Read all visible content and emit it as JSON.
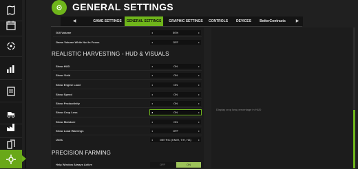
{
  "header": {
    "title": "GENERAL SETTINGS"
  },
  "tabs": {
    "prev_icon": "◀",
    "next_icon": "▶",
    "items": [
      {
        "label": "GAME SETTINGS"
      },
      {
        "label": "GENERAL SETTINGS",
        "active": true
      },
      {
        "label": "GRAPHIC SETTINGS"
      },
      {
        "label": "CONTROLS"
      },
      {
        "label": "DEVICES"
      },
      {
        "label": "BetterContracts"
      }
    ]
  },
  "settings": {
    "rows_top": [
      {
        "label": "GUI Volume",
        "value": "50%"
      },
      {
        "label": "Game Volume While Not In Focus",
        "value": "OFF"
      }
    ],
    "section_rh": {
      "title": "REALISTIC HARVESTING - HUD & VISUALS"
    },
    "rows_rh": [
      {
        "label": "Show HUD",
        "value": "ON"
      },
      {
        "label": "Show Yield",
        "value": "ON"
      },
      {
        "label": "Show Engine Load",
        "value": "ON"
      },
      {
        "label": "Show Speed",
        "value": "ON"
      },
      {
        "label": "Show Productivity",
        "value": "ON"
      },
      {
        "label": "Show Crop Loss",
        "value": "ON",
        "focused": true
      },
      {
        "label": "Show Moisture",
        "value": "ON"
      },
      {
        "label": "Show Load Warnings",
        "value": "OFF"
      },
      {
        "label": "Units",
        "value": "METRIC (KM/H, T/H, HA)"
      }
    ],
    "section_pf": {
      "title": "PRECISION FARMING"
    },
    "rows_pf": [
      {
        "label": "Help Window Always Active",
        "off_label": "OFF",
        "on_label": "ON",
        "selected": "ON"
      }
    ]
  },
  "right_panel": {
    "description": "Display crop loss percentage in HUD"
  },
  "colors": {
    "accent": "#6fb51b",
    "background": "#202020",
    "panel": "#1b1b1b"
  },
  "sidebar": {
    "items": [
      {
        "icon": "map-icon"
      },
      {
        "icon": "calendar-icon"
      },
      {
        "icon": "cycle-icon"
      },
      {
        "icon": "stats-icon"
      },
      {
        "icon": "finance-icon"
      },
      {
        "icon": "vehicles-icon"
      },
      {
        "icon": "production-icon"
      },
      {
        "icon": "contracts-icon"
      },
      {
        "icon": "settings-icon",
        "active": true
      }
    ]
  }
}
